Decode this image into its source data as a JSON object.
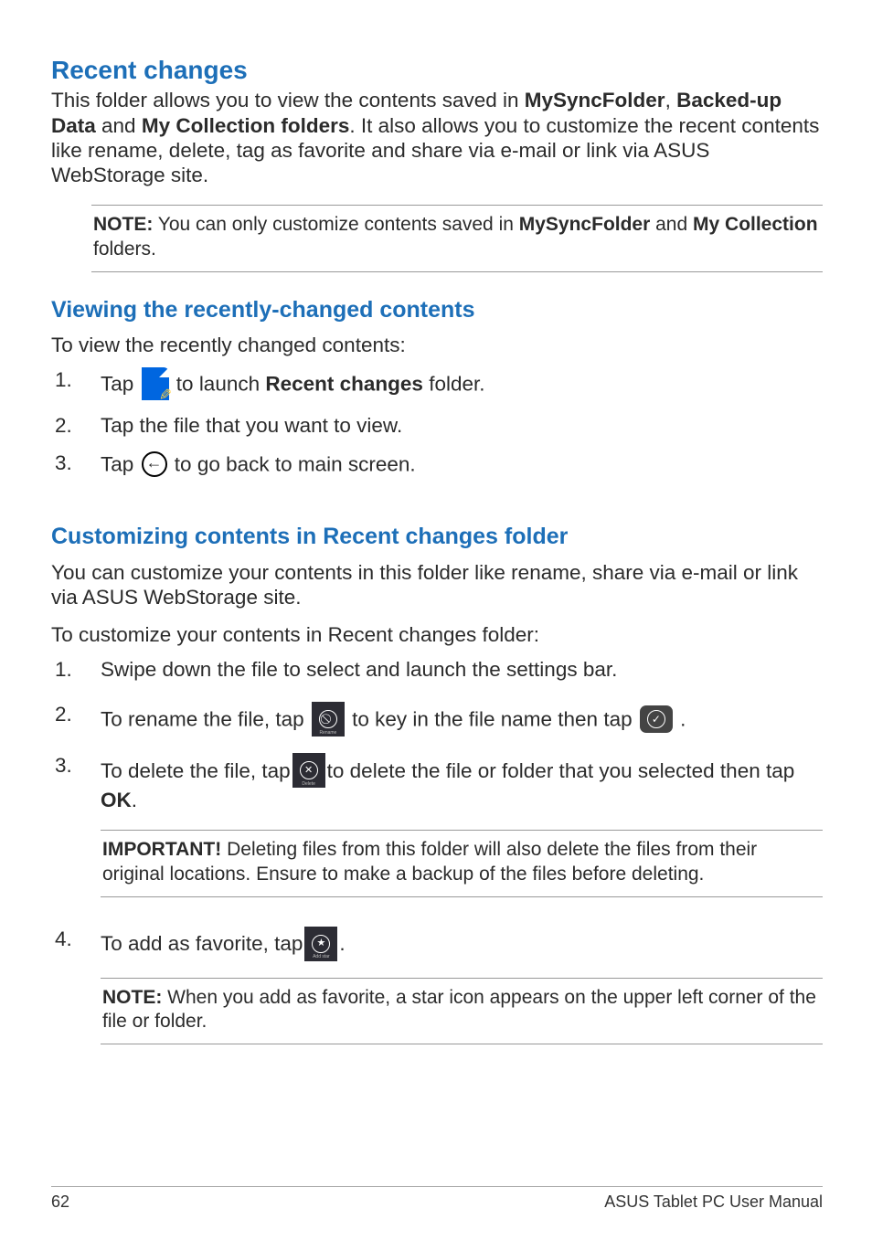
{
  "headings": {
    "main": "Recent changes",
    "viewing": "Viewing the recently-changed contents",
    "customizing": "Customizing contents in Recent changes folder"
  },
  "intro": {
    "pre": "This folder allows you to view the contents saved in ",
    "b1": "MySyncFolder",
    "comma": ", ",
    "b2": "Backed-up Data",
    "and": " and ",
    "b3": "My Collection folders",
    "post": ". It also allows you to customize the recent contents like rename, delete, tag as favorite and share via e-mail or link via ASUS WebStorage site."
  },
  "note1": {
    "label": "NOTE:",
    "pre": "  You can only customize contents saved in ",
    "b1": "MySyncFolder",
    "and": " and ",
    "b2": "My Collection",
    "post": " folders."
  },
  "viewing": {
    "lead": "To view the recently changed contents:",
    "s1_pre": "Tap ",
    "s1_mid": " to launch ",
    "s1_bold": "Recent changes",
    "s1_post": " folder.",
    "s2": "Tap the file that you want to view.",
    "s3_pre": "Tap ",
    "s3_post": " to go back to main screen."
  },
  "custom": {
    "lead": "You can customize your contents in this folder like rename, share via e-mail or link via ASUS WebStorage site.",
    "lead2": "To customize your contents in Recent changes folder:",
    "s1": "Swipe down the file to select and launch the settings bar.",
    "s2_pre": "To rename the file, tap ",
    "s2_mid": " to key in the file name then tap ",
    "s2_post": ".",
    "s3_pre": "To delete the file, tap ",
    "s3_mid": " to delete the file or folder that you selected then tap ",
    "s3_bold": "OK",
    "s3_post": ".",
    "s4_pre": "To add as favorite, tap ",
    "s4_post": "."
  },
  "important": {
    "label": "IMPORTANT!",
    "text": "  Deleting files from this folder will also delete the files from their original locations. Ensure to make a backup of the files before deleting."
  },
  "note2": {
    "label": "NOTE:",
    "text": "  When you add as favorite, a star icon appears on the upper left corner of the file or folder."
  },
  "footer": {
    "page": "62",
    "title": "ASUS Tablet PC User Manual"
  },
  "icon_labels": {
    "rename": "Rename",
    "delete": "Delete",
    "addstar": "Add star"
  }
}
